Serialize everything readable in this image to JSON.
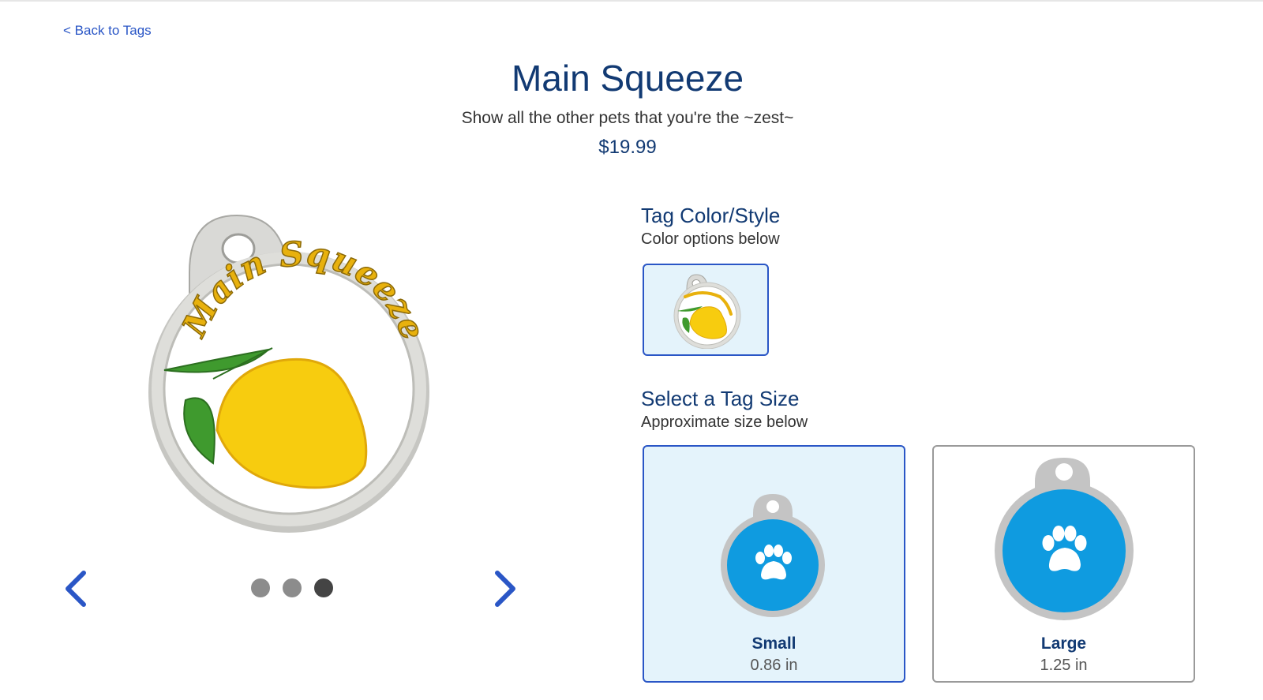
{
  "nav": {
    "back_label": "< Back to Tags"
  },
  "product": {
    "title": "Main Squeeze",
    "subtitle": "Show all the other pets that you're the ~zest~",
    "price": "$19.99",
    "tag_text": "Main Squeeze"
  },
  "carousel": {
    "slide_count": 3,
    "active_index": 2
  },
  "color_section": {
    "title": "Tag Color/Style",
    "subtitle": "Color options below"
  },
  "size_section": {
    "title": "Select a Tag Size",
    "subtitle": "Approximate size below",
    "options": [
      {
        "name": "Small",
        "value": "0.86 in",
        "selected": true
      },
      {
        "name": "Large",
        "value": "1.25 in",
        "selected": false
      }
    ]
  },
  "colors": {
    "brand_blue": "#123a73",
    "link_blue": "#2a56c6",
    "selected_bg": "#e4f3fb",
    "tag_blue": "#0f9be0",
    "lemon_yellow": "#f7cc0f",
    "leaf_green": "#3f9a2e"
  },
  "icons": {
    "prev": "chevron-left-icon",
    "next": "chevron-right-icon",
    "paw": "paw-icon"
  }
}
